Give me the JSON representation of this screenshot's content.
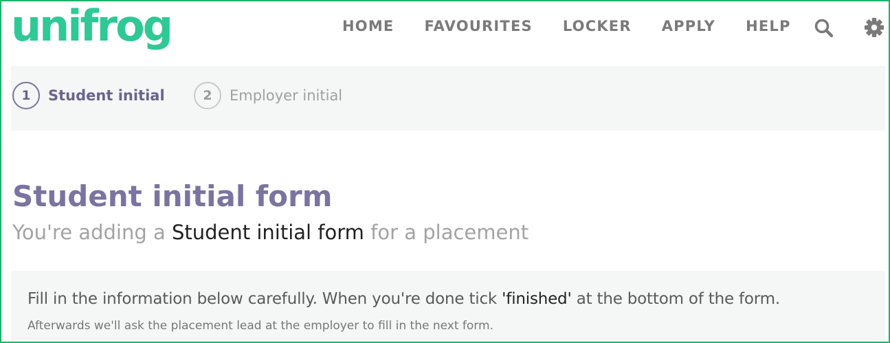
{
  "header": {
    "logo_text": "unifrog",
    "nav": [
      "HOME",
      "FAVOURITES",
      "LOCKER",
      "APPLY",
      "HELP"
    ],
    "icons": {
      "search": "search-icon",
      "settings": "gear-icon"
    },
    "colors": {
      "logo": "#2ec994",
      "nav": "#7a7a7a",
      "frame_border": "#1db36b"
    }
  },
  "stepper": {
    "steps": [
      {
        "number": "1",
        "label": "Student initial",
        "state": "active"
      },
      {
        "number": "2",
        "label": "Employer initial",
        "state": "inactive"
      }
    ],
    "colors": {
      "active": "#7b73a0",
      "inactive": "#a0a0a0"
    }
  },
  "main": {
    "title": "Student initial form",
    "subtitle": {
      "prefix": "You're adding a ",
      "highlight": "Student initial form",
      "suffix": " for a placement"
    },
    "info": {
      "line1_prefix": "Fill in the information below carefully. When you're done tick ",
      "line1_highlight": "'finished'",
      "line1_suffix": " at the bottom of the form.",
      "line2": "Afterwards we'll ask the placement lead at the employer to fill in the next form."
    }
  }
}
